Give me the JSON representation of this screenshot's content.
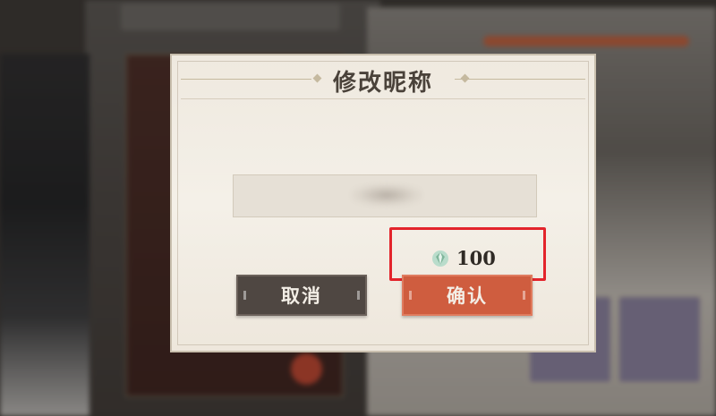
{
  "dialog": {
    "title": "修改昵称",
    "name_input": {
      "value": "",
      "placeholder": ""
    },
    "cost": {
      "currency_icon": "gem-icon",
      "amount": "100"
    },
    "buttons": {
      "cancel_label": "取消",
      "confirm_label": "确认"
    }
  },
  "colors": {
    "dialog_bg": "#f4f0e8",
    "cancel_button": "#4f4742",
    "confirm_button": "#cf5d3f",
    "highlight": "#e3242b",
    "gem": "#7fb59a"
  }
}
